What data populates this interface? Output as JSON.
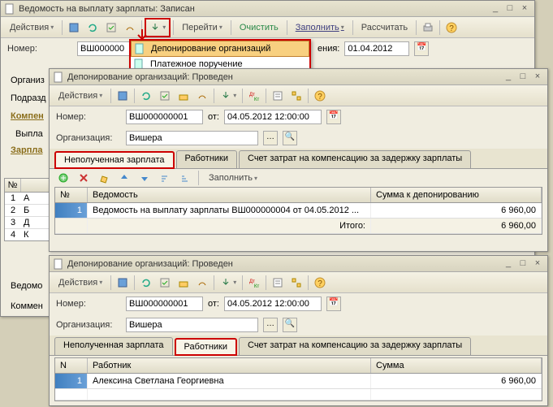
{
  "win1": {
    "title": "Ведомость на выплату зарплаты: Записан",
    "actions_label": "Действия",
    "menu": {
      "goto": "Перейти",
      "clear": "Очистить",
      "fill": "Заполнить",
      "calc": "Рассчитать"
    },
    "num_label": "Номер:",
    "num_val": "ВШ000000",
    "date_prefix": "ения:",
    "date_val": "01.04.2012",
    "org_label": "Организ",
    "sub_label": "Подразд",
    "comp_label": "Компен",
    "pay_label": "Выпла",
    "zarpl_label": "Зарпла",
    "side_rows": [
      "А",
      "Б",
      "Д",
      "К"
    ],
    "popup": {
      "item1": "Депонирование организаций",
      "item2": "Платежное поручение"
    },
    "bottom1": "Ведомо",
    "bottom2": "Коммен"
  },
  "win2": {
    "title": "Депонирование организаций: Проведен",
    "actions_label": "Действия",
    "num_label": "Номер:",
    "num_val": "ВШ000000001",
    "from_label": "от:",
    "from_val": "04.05.2012 12:00:00",
    "org_label": "Организация:",
    "org_val": "Вишера",
    "tabs": {
      "t1": "Неполученная зарплата",
      "t2": "Работники",
      "t3": "Счет затрат на компенсацию за задержку зарплаты"
    },
    "grid_toolbar_fill": "Заполнить",
    "grid": {
      "head_n": "№",
      "head_ved": "Ведомость",
      "head_sum": "Сумма к депонированию",
      "rownum": "1",
      "ved_text": "Ведомость на выплату зарплаты ВШ000000004 от 04.05.2012 ...",
      "sum": "6 960,00",
      "total_label": "Итого:",
      "total": "6 960,00"
    }
  },
  "win3": {
    "title": "Депонирование организаций: Проведен",
    "actions_label": "Действия",
    "num_label": "Номер:",
    "num_val": "ВШ000000001",
    "from_label": "от:",
    "from_val": "04.05.2012 12:00:00",
    "org_label": "Организация:",
    "org_val": "Вишера",
    "tabs": {
      "t1": "Неполученная зарплата",
      "t2": "Работники",
      "t3": "Счет затрат на компенсацию за задержку зарплаты"
    },
    "grid": {
      "head_n": "N",
      "head_emp": "Работник",
      "head_sum": "Сумма",
      "rownum": "1",
      "emp": "Алексина Светлана Георгиевна",
      "sum": "6 960,00"
    }
  }
}
